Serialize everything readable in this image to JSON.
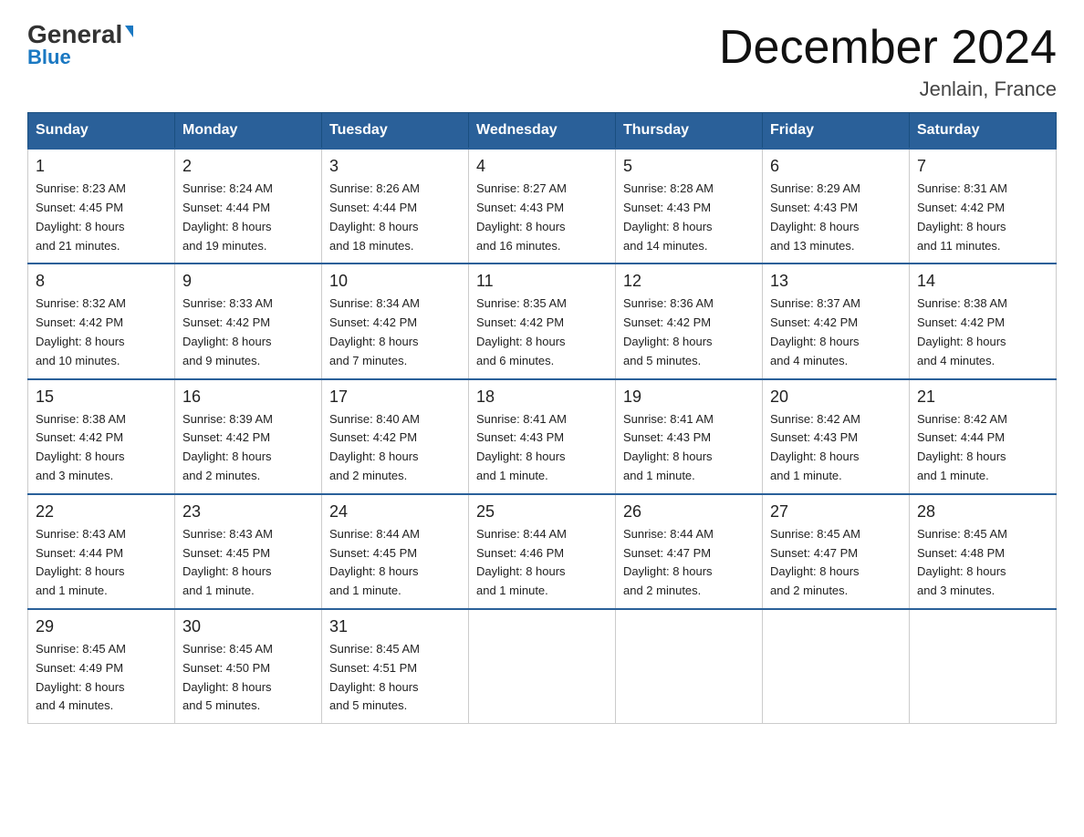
{
  "header": {
    "logo_line1": "General",
    "logo_line2": "Blue",
    "title": "December 2024",
    "location": "Jenlain, France"
  },
  "days_of_week": [
    "Sunday",
    "Monday",
    "Tuesday",
    "Wednesday",
    "Thursday",
    "Friday",
    "Saturday"
  ],
  "weeks": [
    [
      {
        "day": "1",
        "sunrise": "8:23 AM",
        "sunset": "4:45 PM",
        "daylight": "8 hours and 21 minutes."
      },
      {
        "day": "2",
        "sunrise": "8:24 AM",
        "sunset": "4:44 PM",
        "daylight": "8 hours and 19 minutes."
      },
      {
        "day": "3",
        "sunrise": "8:26 AM",
        "sunset": "4:44 PM",
        "daylight": "8 hours and 18 minutes."
      },
      {
        "day": "4",
        "sunrise": "8:27 AM",
        "sunset": "4:43 PM",
        "daylight": "8 hours and 16 minutes."
      },
      {
        "day": "5",
        "sunrise": "8:28 AM",
        "sunset": "4:43 PM",
        "daylight": "8 hours and 14 minutes."
      },
      {
        "day": "6",
        "sunrise": "8:29 AM",
        "sunset": "4:43 PM",
        "daylight": "8 hours and 13 minutes."
      },
      {
        "day": "7",
        "sunrise": "8:31 AM",
        "sunset": "4:42 PM",
        "daylight": "8 hours and 11 minutes."
      }
    ],
    [
      {
        "day": "8",
        "sunrise": "8:32 AM",
        "sunset": "4:42 PM",
        "daylight": "8 hours and 10 minutes."
      },
      {
        "day": "9",
        "sunrise": "8:33 AM",
        "sunset": "4:42 PM",
        "daylight": "8 hours and 9 minutes."
      },
      {
        "day": "10",
        "sunrise": "8:34 AM",
        "sunset": "4:42 PM",
        "daylight": "8 hours and 7 minutes."
      },
      {
        "day": "11",
        "sunrise": "8:35 AM",
        "sunset": "4:42 PM",
        "daylight": "8 hours and 6 minutes."
      },
      {
        "day": "12",
        "sunrise": "8:36 AM",
        "sunset": "4:42 PM",
        "daylight": "8 hours and 5 minutes."
      },
      {
        "day": "13",
        "sunrise": "8:37 AM",
        "sunset": "4:42 PM",
        "daylight": "8 hours and 4 minutes."
      },
      {
        "day": "14",
        "sunrise": "8:38 AM",
        "sunset": "4:42 PM",
        "daylight": "8 hours and 4 minutes."
      }
    ],
    [
      {
        "day": "15",
        "sunrise": "8:38 AM",
        "sunset": "4:42 PM",
        "daylight": "8 hours and 3 minutes."
      },
      {
        "day": "16",
        "sunrise": "8:39 AM",
        "sunset": "4:42 PM",
        "daylight": "8 hours and 2 minutes."
      },
      {
        "day": "17",
        "sunrise": "8:40 AM",
        "sunset": "4:42 PM",
        "daylight": "8 hours and 2 minutes."
      },
      {
        "day": "18",
        "sunrise": "8:41 AM",
        "sunset": "4:43 PM",
        "daylight": "8 hours and 1 minute."
      },
      {
        "day": "19",
        "sunrise": "8:41 AM",
        "sunset": "4:43 PM",
        "daylight": "8 hours and 1 minute."
      },
      {
        "day": "20",
        "sunrise": "8:42 AM",
        "sunset": "4:43 PM",
        "daylight": "8 hours and 1 minute."
      },
      {
        "day": "21",
        "sunrise": "8:42 AM",
        "sunset": "4:44 PM",
        "daylight": "8 hours and 1 minute."
      }
    ],
    [
      {
        "day": "22",
        "sunrise": "8:43 AM",
        "sunset": "4:44 PM",
        "daylight": "8 hours and 1 minute."
      },
      {
        "day": "23",
        "sunrise": "8:43 AM",
        "sunset": "4:45 PM",
        "daylight": "8 hours and 1 minute."
      },
      {
        "day": "24",
        "sunrise": "8:44 AM",
        "sunset": "4:45 PM",
        "daylight": "8 hours and 1 minute."
      },
      {
        "day": "25",
        "sunrise": "8:44 AM",
        "sunset": "4:46 PM",
        "daylight": "8 hours and 1 minute."
      },
      {
        "day": "26",
        "sunrise": "8:44 AM",
        "sunset": "4:47 PM",
        "daylight": "8 hours and 2 minutes."
      },
      {
        "day": "27",
        "sunrise": "8:45 AM",
        "sunset": "4:47 PM",
        "daylight": "8 hours and 2 minutes."
      },
      {
        "day": "28",
        "sunrise": "8:45 AM",
        "sunset": "4:48 PM",
        "daylight": "8 hours and 3 minutes."
      }
    ],
    [
      {
        "day": "29",
        "sunrise": "8:45 AM",
        "sunset": "4:49 PM",
        "daylight": "8 hours and 4 minutes."
      },
      {
        "day": "30",
        "sunrise": "8:45 AM",
        "sunset": "4:50 PM",
        "daylight": "8 hours and 5 minutes."
      },
      {
        "day": "31",
        "sunrise": "8:45 AM",
        "sunset": "4:51 PM",
        "daylight": "8 hours and 5 minutes."
      },
      null,
      null,
      null,
      null
    ]
  ],
  "labels": {
    "sunrise": "Sunrise:",
    "sunset": "Sunset:",
    "daylight": "Daylight:"
  }
}
